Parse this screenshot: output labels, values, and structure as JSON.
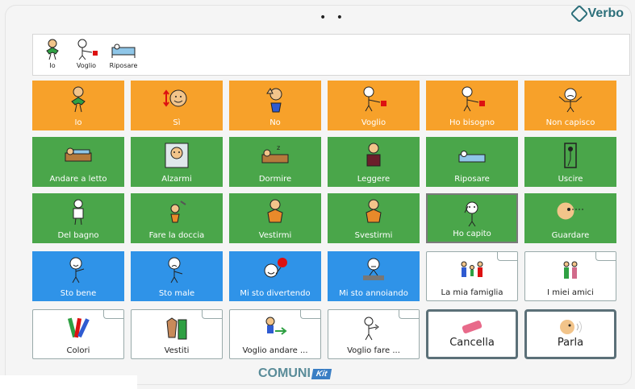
{
  "brand": {
    "name": "Verbo",
    "accent": "#2c6f7a"
  },
  "camera": "• •",
  "sentence": [
    {
      "label": "Io",
      "icon": "io-person-icon"
    },
    {
      "label": "Voglio",
      "icon": "voglio-hand-icon"
    },
    {
      "label": "Riposare",
      "icon": "riposare-bed-icon"
    }
  ],
  "grid": {
    "row1": [
      {
        "label": "Io",
        "color": "#f7a12a"
      },
      {
        "label": "Sì",
        "color": "#f7a12a"
      },
      {
        "label": "No",
        "color": "#f7a12a"
      },
      {
        "label": "Voglio",
        "color": "#f7a12a"
      },
      {
        "label": "Ho bisogno",
        "color": "#f7a12a"
      },
      {
        "label": "Non capisco",
        "color": "#f7a12a"
      }
    ],
    "row2": [
      {
        "label": "Andare a letto"
      },
      {
        "label": "Alzarmi"
      },
      {
        "label": "Dormire"
      },
      {
        "label": "Leggere"
      },
      {
        "label": "Riposare"
      },
      {
        "label": "Uscire"
      }
    ],
    "row3": [
      {
        "label": "Del bagno"
      },
      {
        "label": "Fare la doccia"
      },
      {
        "label": "Vestirmi"
      },
      {
        "label": "Svestirmi"
      },
      {
        "label": "Ho capito"
      },
      {
        "label": "Guardare"
      }
    ],
    "row4": [
      {
        "label": "Sto bene"
      },
      {
        "label": "Sto male"
      },
      {
        "label": "Mi sto divertendo"
      },
      {
        "label": "Mi sto annoiando"
      },
      {
        "label": "La mia famiglia"
      },
      {
        "label": "I miei amici"
      }
    ],
    "row5": [
      {
        "label": "Colori"
      },
      {
        "label": "Vestiti"
      },
      {
        "label": "Voglio andare ..."
      },
      {
        "label": "Voglio fare ..."
      },
      {
        "label": "Cancella"
      },
      {
        "label": "Parla"
      }
    ]
  },
  "footer": {
    "logo": "COMUNI",
    "kit": "Kit"
  },
  "colors": {
    "orange": "#f7a12a",
    "green": "#4aa64a",
    "blue": "#2f93e8",
    "action_border": "#5b7078"
  }
}
